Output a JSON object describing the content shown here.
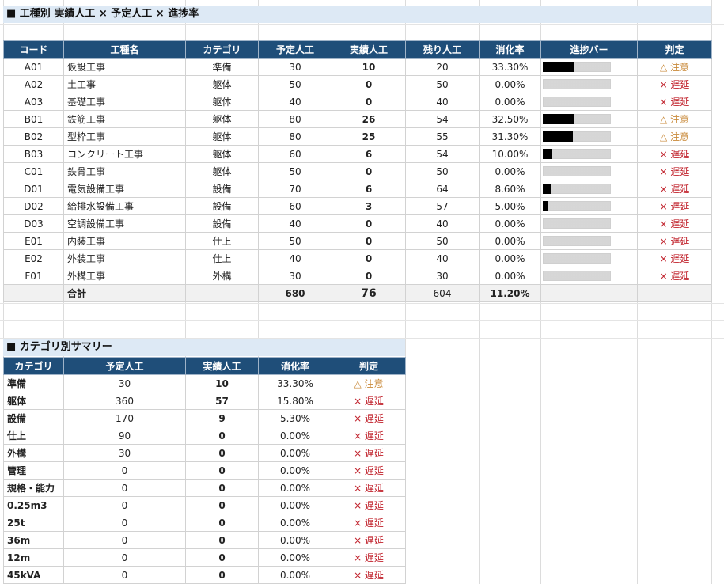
{
  "section1": {
    "title": "■ 工種別 実績人工 × 予定人工 × 進捗率"
  },
  "table1": {
    "headers": [
      "コード",
      "工種名",
      "カテゴリ",
      "予定人工",
      "実績人工",
      "残り人工",
      "消化率",
      "進捗バー",
      "判定"
    ],
    "rows": [
      {
        "code": "A01",
        "name": "仮設工事",
        "cat": "準備",
        "plan": "30",
        "actual": "10",
        "remain": "20",
        "rate": "33.30%",
        "progress": 0.333,
        "verdict": "△ 注意",
        "level": "warn"
      },
      {
        "code": "A02",
        "name": "土工事",
        "cat": "躯体",
        "plan": "50",
        "actual": "0",
        "remain": "50",
        "rate": "0.00%",
        "progress": 0,
        "verdict": "× 遅延",
        "level": "late"
      },
      {
        "code": "A03",
        "name": "基礎工事",
        "cat": "躯体",
        "plan": "40",
        "actual": "0",
        "remain": "40",
        "rate": "0.00%",
        "progress": 0,
        "verdict": "× 遅延",
        "level": "late"
      },
      {
        "code": "B01",
        "name": "鉄筋工事",
        "cat": "躯体",
        "plan": "80",
        "actual": "26",
        "remain": "54",
        "rate": "32.50%",
        "progress": 0.325,
        "verdict": "△ 注意",
        "level": "warn"
      },
      {
        "code": "B02",
        "name": "型枠工事",
        "cat": "躯体",
        "plan": "80",
        "actual": "25",
        "remain": "55",
        "rate": "31.30%",
        "progress": 0.313,
        "verdict": "△ 注意",
        "level": "warn"
      },
      {
        "code": "B03",
        "name": "コンクリート工事",
        "cat": "躯体",
        "plan": "60",
        "actual": "6",
        "remain": "54",
        "rate": "10.00%",
        "progress": 0.1,
        "verdict": "× 遅延",
        "level": "late"
      },
      {
        "code": "C01",
        "name": "鉄骨工事",
        "cat": "躯体",
        "plan": "50",
        "actual": "0",
        "remain": "50",
        "rate": "0.00%",
        "progress": 0,
        "verdict": "× 遅延",
        "level": "late"
      },
      {
        "code": "D01",
        "name": "電気設備工事",
        "cat": "設備",
        "plan": "70",
        "actual": "6",
        "remain": "64",
        "rate": "8.60%",
        "progress": 0.086,
        "verdict": "× 遅延",
        "level": "late"
      },
      {
        "code": "D02",
        "name": "給排水設備工事",
        "cat": "設備",
        "plan": "60",
        "actual": "3",
        "remain": "57",
        "rate": "5.00%",
        "progress": 0.05,
        "verdict": "× 遅延",
        "level": "late"
      },
      {
        "code": "D03",
        "name": "空調設備工事",
        "cat": "設備",
        "plan": "40",
        "actual": "0",
        "remain": "40",
        "rate": "0.00%",
        "progress": 0,
        "verdict": "× 遅延",
        "level": "late"
      },
      {
        "code": "E01",
        "name": "内装工事",
        "cat": "仕上",
        "plan": "50",
        "actual": "0",
        "remain": "50",
        "rate": "0.00%",
        "progress": 0,
        "verdict": "× 遅延",
        "level": "late"
      },
      {
        "code": "E02",
        "name": "外装工事",
        "cat": "仕上",
        "plan": "40",
        "actual": "0",
        "remain": "40",
        "rate": "0.00%",
        "progress": 0,
        "verdict": "× 遅延",
        "level": "late"
      },
      {
        "code": "F01",
        "name": "外構工事",
        "cat": "外構",
        "plan": "30",
        "actual": "0",
        "remain": "30",
        "rate": "0.00%",
        "progress": 0,
        "verdict": "× 遅延",
        "level": "late"
      }
    ],
    "total": {
      "label": "合計",
      "plan": "680",
      "actual": "76",
      "remain": "604",
      "rate": "11.20%"
    }
  },
  "section2": {
    "title": "■ カテゴリ別サマリー"
  },
  "table2": {
    "headers": [
      "カテゴリ",
      "予定人工",
      "実績人工",
      "消化率",
      "判定"
    ],
    "rows": [
      {
        "cat": "準備",
        "plan": "30",
        "actual": "10",
        "rate": "33.30%",
        "verdict": "△ 注意",
        "level": "warn"
      },
      {
        "cat": "躯体",
        "plan": "360",
        "actual": "57",
        "rate": "15.80%",
        "verdict": "× 遅延",
        "level": "late"
      },
      {
        "cat": "設備",
        "plan": "170",
        "actual": "9",
        "rate": "5.30%",
        "verdict": "× 遅延",
        "level": "late"
      },
      {
        "cat": "仕上",
        "plan": "90",
        "actual": "0",
        "rate": "0.00%",
        "verdict": "× 遅延",
        "level": "late"
      },
      {
        "cat": "外構",
        "plan": "30",
        "actual": "0",
        "rate": "0.00%",
        "verdict": "× 遅延",
        "level": "late"
      },
      {
        "cat": "管理",
        "plan": "0",
        "actual": "0",
        "rate": "0.00%",
        "verdict": "× 遅延",
        "level": "late"
      },
      {
        "cat": "規格・能力",
        "plan": "0",
        "actual": "0",
        "rate": "0.00%",
        "verdict": "× 遅延",
        "level": "late"
      },
      {
        "cat": "0.25m3",
        "plan": "0",
        "actual": "0",
        "rate": "0.00%",
        "verdict": "× 遅延",
        "level": "late"
      },
      {
        "cat": "25t",
        "plan": "0",
        "actual": "0",
        "rate": "0.00%",
        "verdict": "× 遅延",
        "level": "late"
      },
      {
        "cat": "36m",
        "plan": "0",
        "actual": "0",
        "rate": "0.00%",
        "verdict": "× 遅延",
        "level": "late"
      },
      {
        "cat": "12m",
        "plan": "0",
        "actual": "0",
        "rate": "0.00%",
        "verdict": "× 遅延",
        "level": "late"
      },
      {
        "cat": "45kVA",
        "plan": "0",
        "actual": "0",
        "rate": "0.00%",
        "verdict": "× 遅延",
        "level": "late"
      }
    ]
  },
  "colors": {
    "header_bg": "#1f4e79",
    "title_band": "#dde9f5",
    "warn": "#c98a3a",
    "late": "#c0202a",
    "bar": "#000000"
  }
}
